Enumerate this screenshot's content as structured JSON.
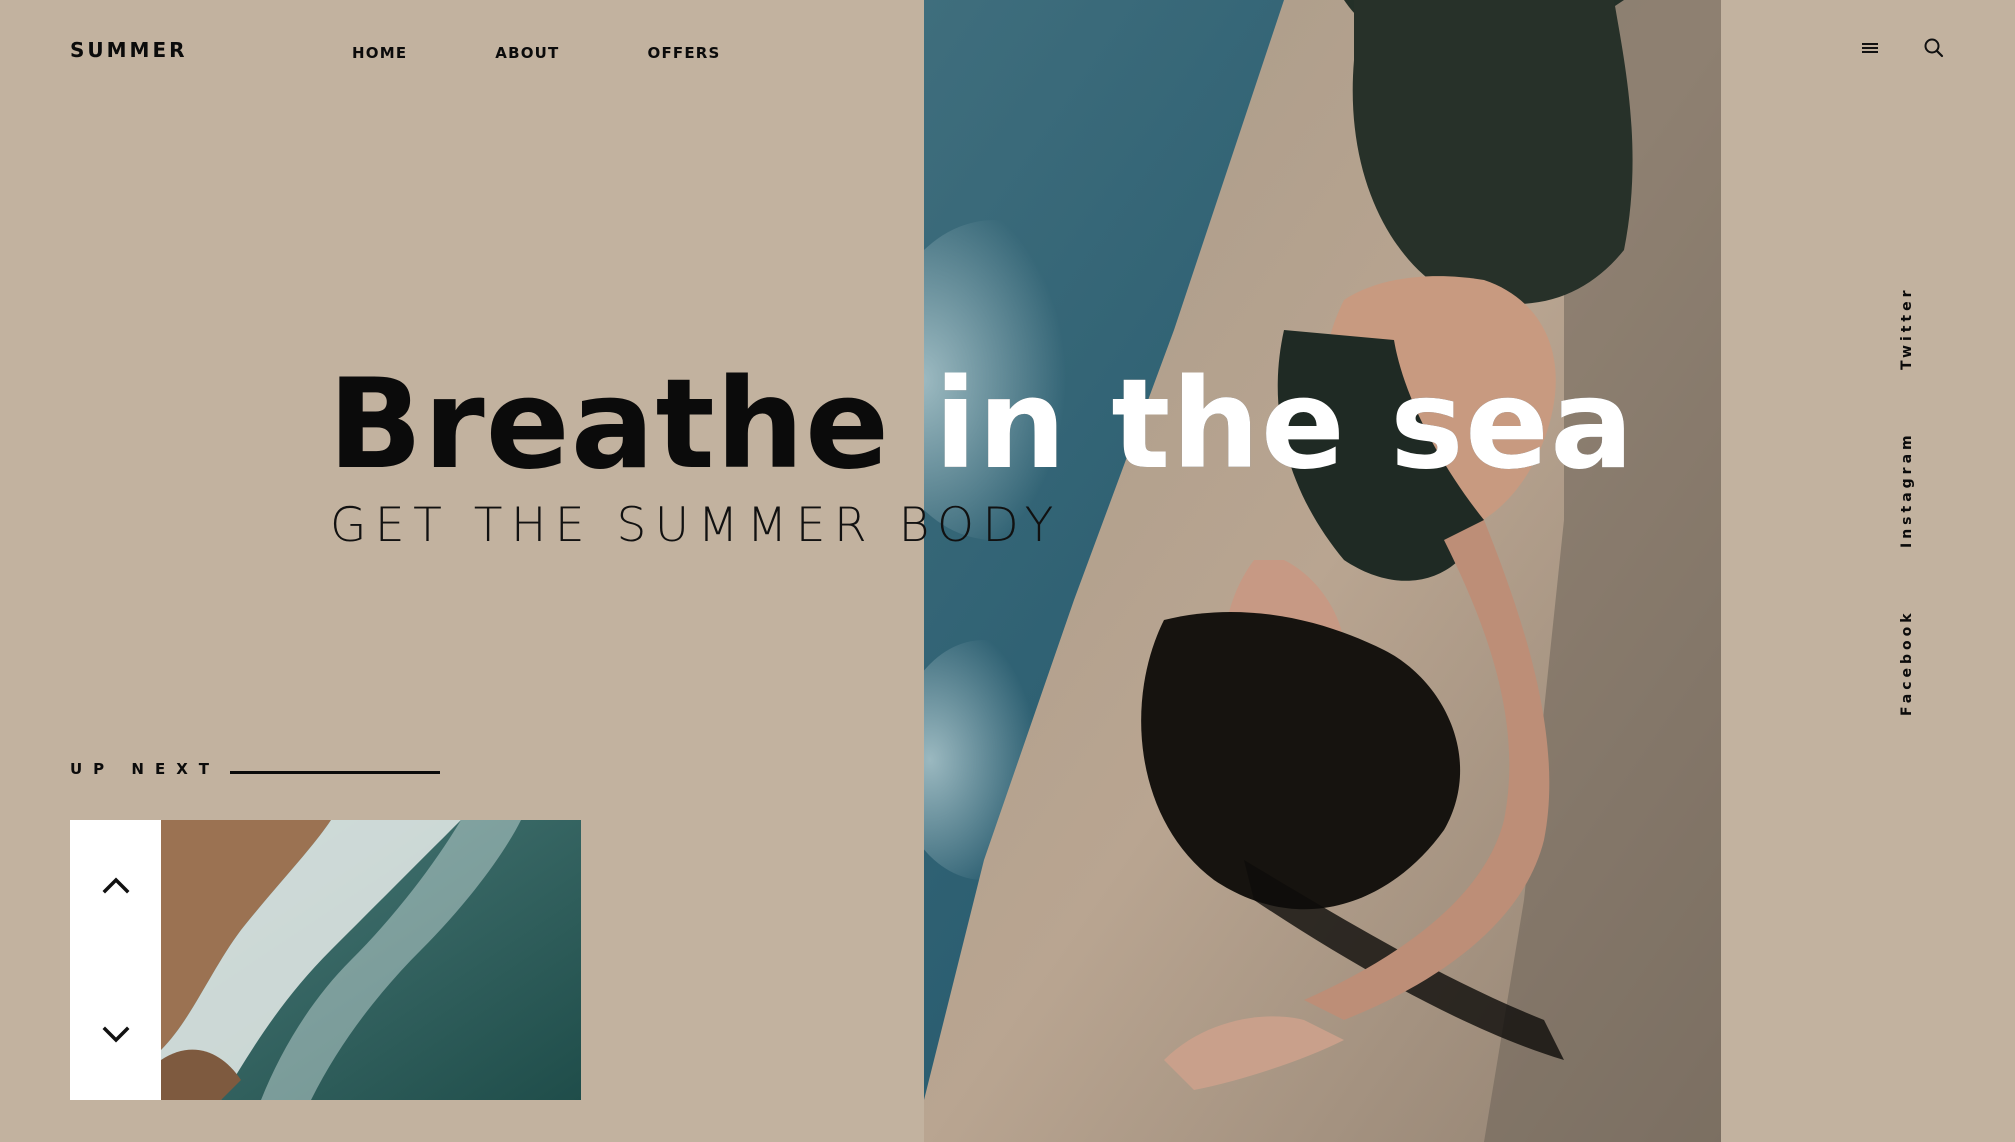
{
  "brand": {
    "logo": "SUMMER"
  },
  "nav": {
    "items": [
      "HOME",
      "ABOUT",
      "OFFERS"
    ]
  },
  "header_icons": {
    "menu": "menu-icon",
    "search": "search-icon"
  },
  "hero": {
    "headline": "Breathe in the sea",
    "subheadline": "GET THE SUMMER BODY"
  },
  "up_next": {
    "label": "UP NEXT",
    "controls": {
      "up": "chevron-up-icon",
      "down": "chevron-down-icon"
    }
  },
  "social": [
    "Twitter",
    "Instagram",
    "Facebook"
  ],
  "colors": {
    "background": "#c2b29f",
    "text": "#0b0b0b",
    "headline_on_photo": "#ffffff",
    "panel": "#ffffff"
  }
}
